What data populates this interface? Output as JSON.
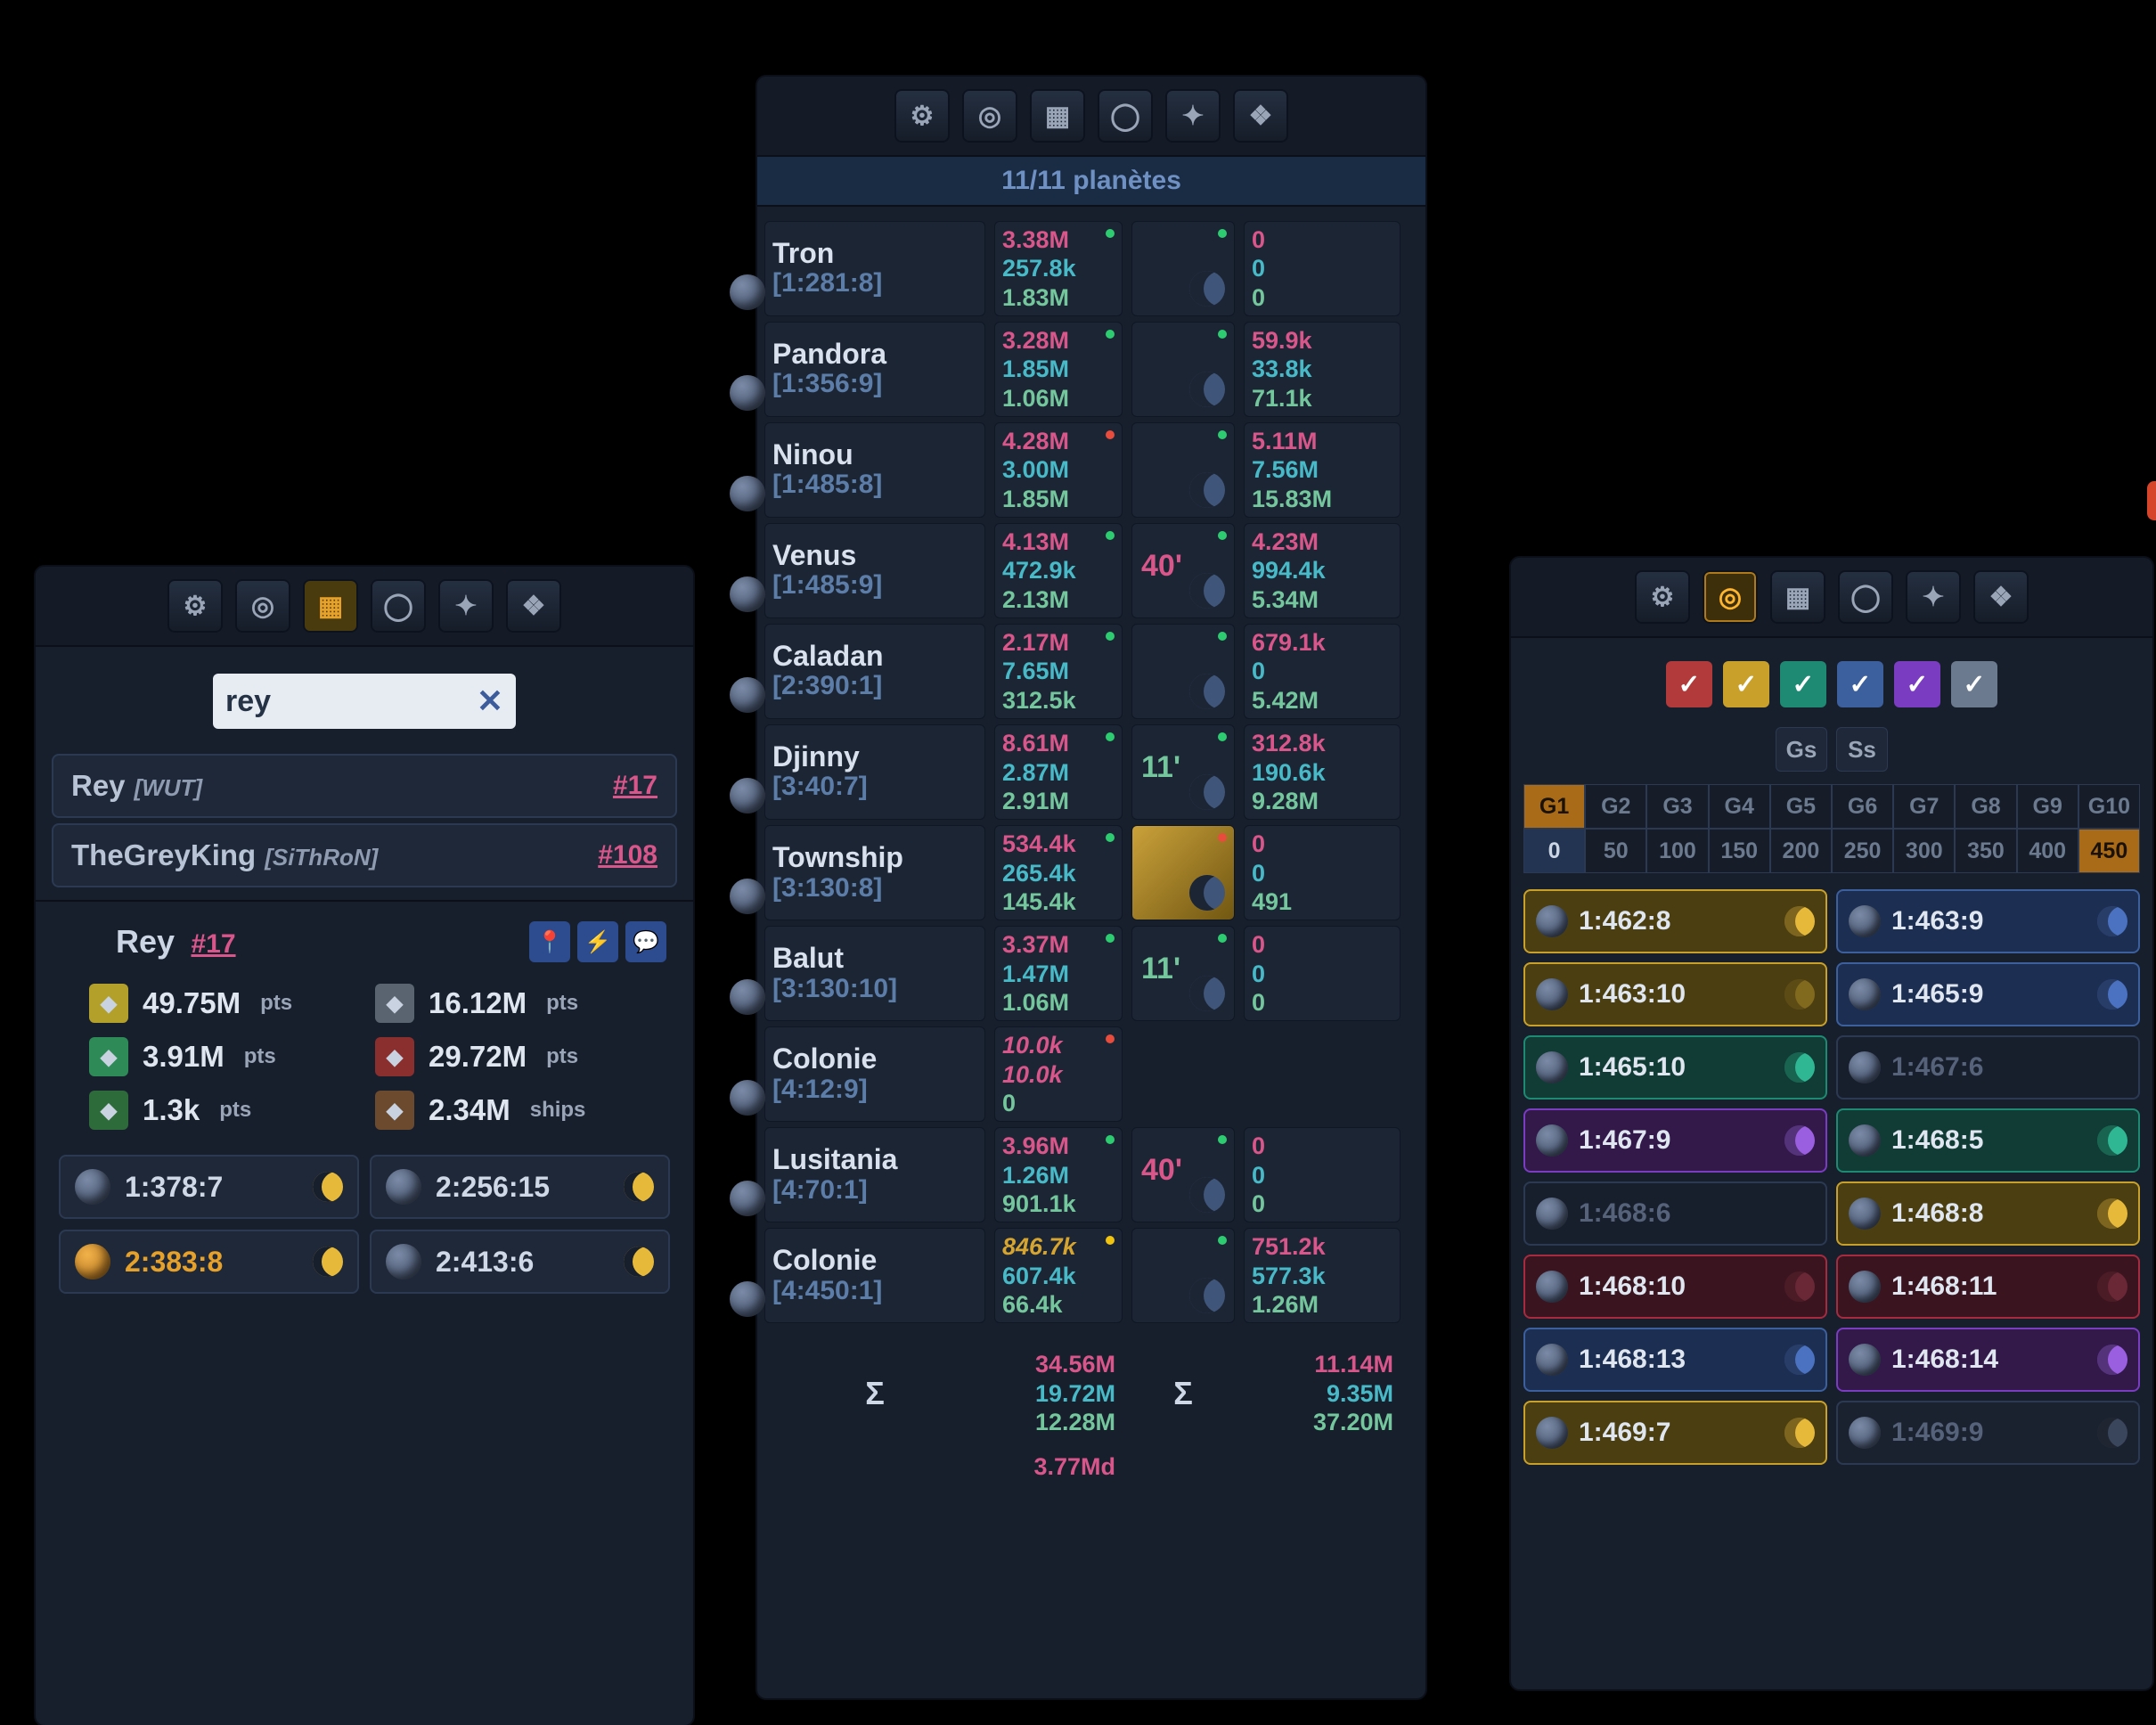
{
  "left": {
    "search_value": "rey",
    "results": [
      {
        "name": "Rey",
        "alliance": "[WUT]",
        "rank": "#17"
      },
      {
        "name": "TheGreyKing",
        "alliance": "[SiThRoN]",
        "rank": "#108"
      }
    ],
    "profile": {
      "name": "Rey",
      "rank": "#17"
    },
    "stats": [
      {
        "val": "49.75M",
        "unit": "pts",
        "bg": "#b2a02a"
      },
      {
        "val": "16.12M",
        "unit": "pts",
        "bg": "#5a6470"
      },
      {
        "val": "3.91M",
        "unit": "pts",
        "bg": "#2e8b57"
      },
      {
        "val": "29.72M",
        "unit": "pts",
        "bg": "#8b2e2e"
      },
      {
        "val": "1.3k",
        "unit": "pts",
        "bg": "#2e6b3a"
      },
      {
        "val": "2.34M",
        "unit": "ships",
        "bg": "#6b4a2e"
      }
    ],
    "coords": [
      {
        "c": "1:378:7",
        "hl": false
      },
      {
        "c": "2:256:15",
        "hl": false
      },
      {
        "c": "2:383:8",
        "hl": true
      },
      {
        "c": "2:413:6",
        "hl": false
      }
    ]
  },
  "center": {
    "subtitle": "11/11 planètes",
    "planets": [
      {
        "name": "Tron",
        "crd": "[1:281:8]",
        "dot": "g",
        "r1": "3.38M",
        "r2": "257.8k",
        "r3": "1.83M",
        "mdot": "g",
        "m1": "0",
        "m2": "0",
        "m3": "0",
        "moon": ""
      },
      {
        "name": "Pandora",
        "crd": "[1:356:9]",
        "dot": "g",
        "r1": "3.28M",
        "r2": "1.85M",
        "r3": "1.06M",
        "mdot": "g",
        "m1": "59.9k",
        "m2": "33.8k",
        "m3": "71.1k",
        "moon": ""
      },
      {
        "name": "Ninou",
        "crd": "[1:485:8]",
        "dot": "r",
        "r1": "4.28M",
        "r2": "3.00M",
        "r3": "1.85M",
        "mdot": "g",
        "m1": "5.11M",
        "m2": "7.56M",
        "m3": "15.83M",
        "moon": ""
      },
      {
        "name": "Venus",
        "crd": "[1:485:9]",
        "dot": "g",
        "r1": "4.13M",
        "r2": "472.9k",
        "r3": "2.13M",
        "mdot": "g",
        "m1": "4.23M",
        "m2": "994.4k",
        "m3": "5.34M",
        "moon": "40'",
        "mc": "#d9568b"
      },
      {
        "name": "Caladan",
        "crd": "[2:390:1]",
        "dot": "g",
        "r1": "2.17M",
        "r2": "7.65M",
        "r3": "312.5k",
        "mdot": "g",
        "m1": "679.1k",
        "m2": "0",
        "m3": "5.42M",
        "moon": ""
      },
      {
        "name": "Djinny",
        "crd": "[3:40:7]",
        "dot": "g",
        "r1": "8.61M",
        "r2": "2.87M",
        "r3": "2.91M",
        "mdot": "g",
        "m1": "312.8k",
        "m2": "190.6k",
        "m3": "9.28M",
        "moon": "11'",
        "mc": "#74c69d"
      },
      {
        "name": "Township",
        "crd": "[3:130:8]",
        "dot": "g",
        "r1": "534.4k",
        "r2": "265.4k",
        "r3": "145.4k",
        "mdot": "r",
        "m1": "0",
        "m2": "0",
        "m3": "491",
        "moon": "",
        "sun": true
      },
      {
        "name": "Balut",
        "crd": "[3:130:10]",
        "dot": "g",
        "r1": "3.37M",
        "r2": "1.47M",
        "r3": "1.06M",
        "mdot": "g",
        "m1": "0",
        "m2": "0",
        "m3": "0",
        "moon": "11'",
        "mc": "#74c69d"
      },
      {
        "name": "Colonie",
        "crd": "[4:12:9]",
        "dot": "r",
        "r1": "10.0k",
        "r2": "10.0k",
        "r3": "0",
        "special": "it",
        "m1": "",
        "m2": "",
        "m3": "",
        "moon": "",
        "nomoon": true
      },
      {
        "name": "Lusitania",
        "crd": "[4:70:1]",
        "dot": "g",
        "r1": "3.96M",
        "r2": "1.26M",
        "r3": "901.1k",
        "mdot": "g",
        "m1": "0",
        "m2": "0",
        "m3": "0",
        "moon": "40'",
        "mc": "#d9568b"
      },
      {
        "name": "Colonie",
        "crd": "[4:450:1]",
        "dot": "y",
        "r1": "846.7k",
        "r2": "607.4k",
        "r3": "66.4k",
        "r1c": "gold",
        "mdot": "g",
        "m1": "751.2k",
        "m2": "577.3k",
        "m3": "1.26M",
        "moon": ""
      }
    ],
    "sum_p": {
      "r1": "34.56M",
      "r2": "19.72M",
      "r3": "12.28M"
    },
    "sum_m": {
      "r1": "11.14M",
      "r2": "9.35M",
      "r3": "37.20M"
    },
    "grand": {
      "r1": "3.77Md"
    },
    "sigma": "Σ"
  },
  "right": {
    "checks": [
      "#b23a3a",
      "#c9a12a",
      "#1e8a73",
      "#3c5f9e",
      "#7a3cc0",
      "#6c7a90"
    ],
    "toggles": [
      "Gs",
      "Ss"
    ],
    "g_row": [
      "G1",
      "G2",
      "G3",
      "G4",
      "G5",
      "G6",
      "G7",
      "G8",
      "G9",
      "G10"
    ],
    "n_row": [
      "0",
      "50",
      "100",
      "150",
      "200",
      "250",
      "300",
      "350",
      "400",
      "450"
    ],
    "g_sel": 0,
    "n_sel0": 0,
    "n_sel9": 9,
    "targets": [
      {
        "c": "1:462:8",
        "k": "yel",
        "m": 1
      },
      {
        "c": "1:463:9",
        "k": "blu",
        "m": 1
      },
      {
        "c": "1:463:10",
        "k": "yel",
        "m": 2
      },
      {
        "c": "1:465:9",
        "k": "blu",
        "m": 1
      },
      {
        "c": "1:465:10",
        "k": "teal",
        "m": 1
      },
      {
        "c": "1:467:6",
        "k": "drk",
        "m": 0
      },
      {
        "c": "1:467:9",
        "k": "pur",
        "m": 1
      },
      {
        "c": "1:468:5",
        "k": "teal",
        "m": 1
      },
      {
        "c": "1:468:6",
        "k": "drk",
        "m": 0
      },
      {
        "c": "1:468:8",
        "k": "yel",
        "m": 1
      },
      {
        "c": "1:468:10",
        "k": "red",
        "m": 2
      },
      {
        "c": "1:468:11",
        "k": "red",
        "m": 2
      },
      {
        "c": "1:468:13",
        "k": "blu",
        "m": 1
      },
      {
        "c": "1:468:14",
        "k": "pur",
        "m": 1
      },
      {
        "c": "1:469:7",
        "k": "yel",
        "m": 1
      },
      {
        "c": "1:469:9",
        "k": "gry",
        "m": 1
      }
    ]
  }
}
